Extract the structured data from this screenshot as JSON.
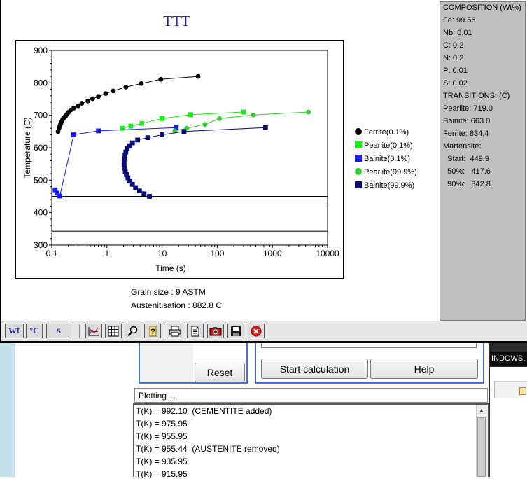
{
  "ttt_window": {
    "title": "TTT",
    "grain_size": "Grain size : 9 ASTM",
    "austenitisation": "Austenitisation : 882.8 C",
    "composition_panel": {
      "lines": [
        "COMPOSITION (Wt%)",
        "Fe: 99.56",
        "Nb: 0.01",
        "C: 0.2",
        "N: 0.2",
        "P: 0.01",
        "S: 0.02",
        "TRANSITIONS: (C)",
        "Pearlite: 719.0",
        "Bainite: 663.0",
        "Ferrite: 834.4",
        "Martensite:",
        "  Start:  449.9",
        "  50%:   417.6",
        "  90%:   342.8"
      ]
    },
    "toolbar": {
      "units_buttons": [
        "wt",
        "°C",
        "s"
      ],
      "icons": [
        "chart-style-icon",
        "grid-icon",
        "zoom-icon",
        "help-icon",
        "print-icon",
        "copy-page-icon",
        "camera-icon",
        "save-icon",
        "close-icon"
      ]
    }
  },
  "chart_data": {
    "type": "line",
    "title": "TTT",
    "xlabel": "Time (s)",
    "ylabel": "Temperature (C)",
    "xscale": "log",
    "xlim": [
      0.1,
      10000
    ],
    "ylim": [
      300,
      900
    ],
    "x_ticks": [
      "0.1",
      "1",
      "10",
      "100",
      "1000",
      "10000"
    ],
    "y_ticks": [
      "300",
      "400",
      "500",
      "600",
      "700",
      "800",
      "900"
    ],
    "legend_position": "right",
    "series": [
      {
        "name": "Ferrite(0.1%)",
        "color": "#000000",
        "marker": "circle",
        "x": [
          0.13,
          0.135,
          0.14,
          0.145,
          0.15,
          0.155,
          0.16,
          0.17,
          0.18,
          0.19,
          0.2,
          0.22,
          0.25,
          0.3,
          0.35,
          0.45,
          0.55,
          0.7,
          0.95,
          1.3,
          2.2,
          4.2,
          9.5,
          45
        ],
        "y": [
          650,
          660,
          667,
          673,
          679,
          684,
          689,
          694,
          699,
          704,
          709,
          716,
          722,
          729,
          737,
          744,
          751,
          758,
          767,
          775,
          787,
          798,
          811,
          820
        ]
      },
      {
        "name": "Pearlite(0.1%)",
        "color": "#16ee16",
        "marker": "square",
        "x": [
          1.9,
          2.7,
          4.3,
          10,
          33,
          300
        ],
        "y": [
          660,
          667,
          675,
          690,
          702,
          710
        ]
      },
      {
        "name": "Bainite(0.1%)",
        "color": "#1a1aff",
        "marker": "square",
        "x": [
          0.115,
          0.125,
          0.14,
          0.25,
          0.7,
          18
        ],
        "y": [
          470,
          460,
          451,
          640,
          652,
          662
        ]
      },
      {
        "name": "Pearlite(99.9%)",
        "color": "#33cc33",
        "marker": "circle",
        "x": [
          17,
          28,
          60,
          110,
          450,
          4500
        ],
        "y": [
          652,
          660,
          672,
          690,
          701,
          710
        ]
      },
      {
        "name": "Bainite(99.9%)",
        "color": "#0a0a78",
        "marker": "square",
        "x": [
          5.9,
          4.7,
          3.9,
          3.3,
          2.9,
          2.6,
          2.4,
          2.25,
          2.15,
          2.08,
          2.05,
          2.05,
          2.08,
          2.13,
          2.2,
          2.33,
          2.55,
          2.9,
          3.6,
          5.5,
          10,
          25,
          750
        ],
        "y": [
          450,
          458,
          467,
          477,
          487,
          497,
          507,
          517,
          527,
          537,
          547,
          557,
          567,
          577,
          587,
          597,
          606,
          615,
          624,
          631,
          640,
          650,
          662
        ]
      }
    ],
    "martensite_lines": [
      449.9,
      417.6,
      342.8
    ]
  },
  "background_app": {
    "reset_label": "Reset",
    "start_label": "Start calculation",
    "help_label": "Help",
    "status_text": "Plotting ...",
    "right_tab_label": "INDOWS.",
    "log_lines": [
      "T(K) = 992.10  (CEMENTITE added)",
      "T(K) = 975.95",
      "T(K) = 955.95",
      "T(K) = 955.44  (AUSTENITE removed)",
      "T(K) = 935.95",
      "T(K) = 915.95"
    ]
  }
}
